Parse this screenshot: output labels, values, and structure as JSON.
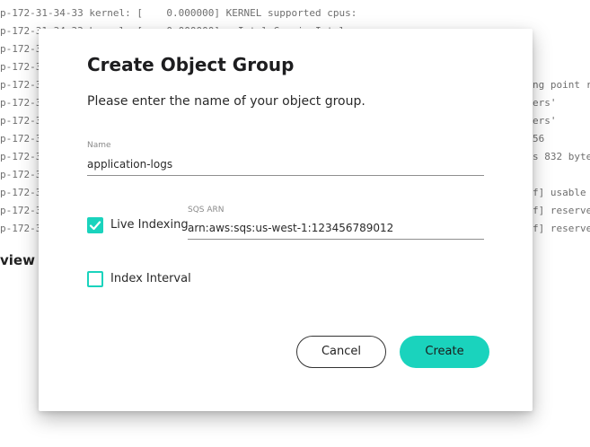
{
  "background": {
    "log_lines": [
      "p-172-31-34-33 kernel: [    0.000000] KERNEL supported cpus:",
      "p-172-31-34-33 kernel: [    0.000000]   Intel GenuineIntel",
      "p-172-3",
      "p-172-3",
      "p-172-3",
      "p-172-3",
      "p-172-3",
      "p-172-3",
      "p-172-3",
      "p-172-3",
      "p-172-3",
      "p-172-3",
      "p-172-3"
    ],
    "log_right": [
      {
        "line": 4,
        "text": "ng point r"
      },
      {
        "line": 5,
        "text": "ers'"
      },
      {
        "line": 6,
        "text": "ers'"
      },
      {
        "line": 7,
        "text": "56"
      },
      {
        "line": 8,
        "text": "s 832 byte"
      },
      {
        "line": 10,
        "text": "f] usable"
      },
      {
        "line": 11,
        "text": "f] reserve"
      },
      {
        "line": 12,
        "text": "f] reserve"
      }
    ],
    "heading": "view"
  },
  "dialog": {
    "title": "Create Object Group",
    "subtitle": "Please enter the name of your object group.",
    "name_field": {
      "label": "Name",
      "value": "application-logs"
    },
    "live_indexing": {
      "label": "Live Indexing",
      "checked": true
    },
    "sqs_field": {
      "label": "SQS ARN",
      "value": "arn:aws:sqs:us-west-1:123456789012"
    },
    "index_interval": {
      "label": "Index Interval",
      "checked": false
    },
    "cancel_label": "Cancel",
    "create_label": "Create",
    "accent_color": "#1ad3bd"
  }
}
